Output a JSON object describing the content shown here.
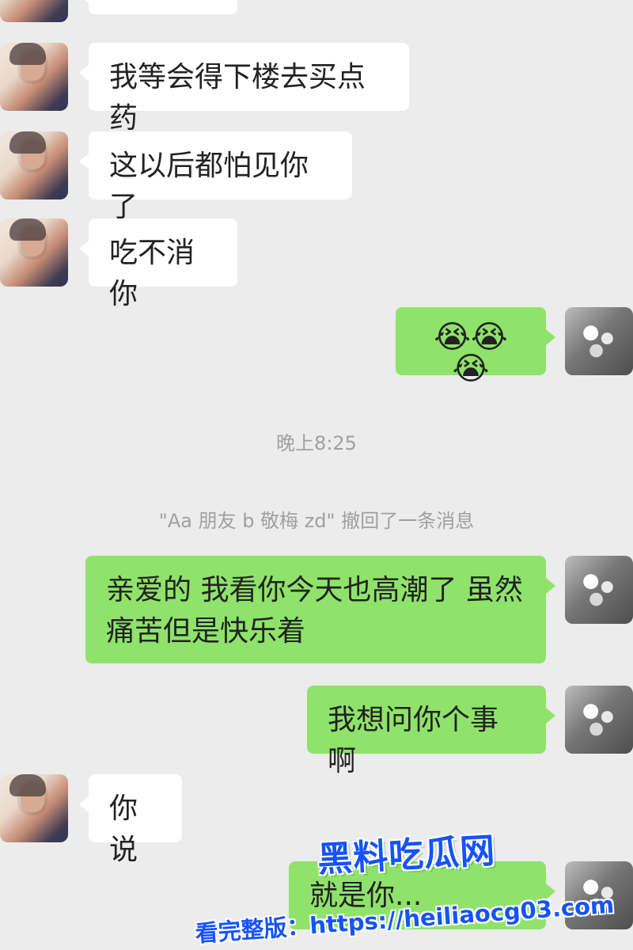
{
  "chat": {
    "messages": [
      {
        "side": "left",
        "text": "我等会得下楼去买点药"
      },
      {
        "side": "left",
        "text": "这以后都怕见你了"
      },
      {
        "side": "left",
        "text": "吃不消你"
      },
      {
        "side": "right",
        "emoji": "😭😭😭"
      },
      {
        "system_timestamp": "晚上8:25"
      },
      {
        "system_recall": "\"Aa 朋友 b 敬梅 zd\" 撤回了一条消息"
      },
      {
        "side": "right",
        "text": "亲爱的 我看你今天也高潮了 虽然痛苦但是快乐着"
      },
      {
        "side": "right",
        "text": "我想问你个事啊"
      },
      {
        "side": "left",
        "text": "你说"
      },
      {
        "side": "right",
        "text": "就是你..."
      }
    ]
  },
  "watermark": {
    "brand": "黑料吃瓜网",
    "text": "看完整版：https://heiliaocg03.com"
  },
  "colors": {
    "background": "#ececec",
    "left_bubble": "#ffffff",
    "right_bubble": "#8fe36a",
    "watermark_blue": "#1553ff"
  }
}
